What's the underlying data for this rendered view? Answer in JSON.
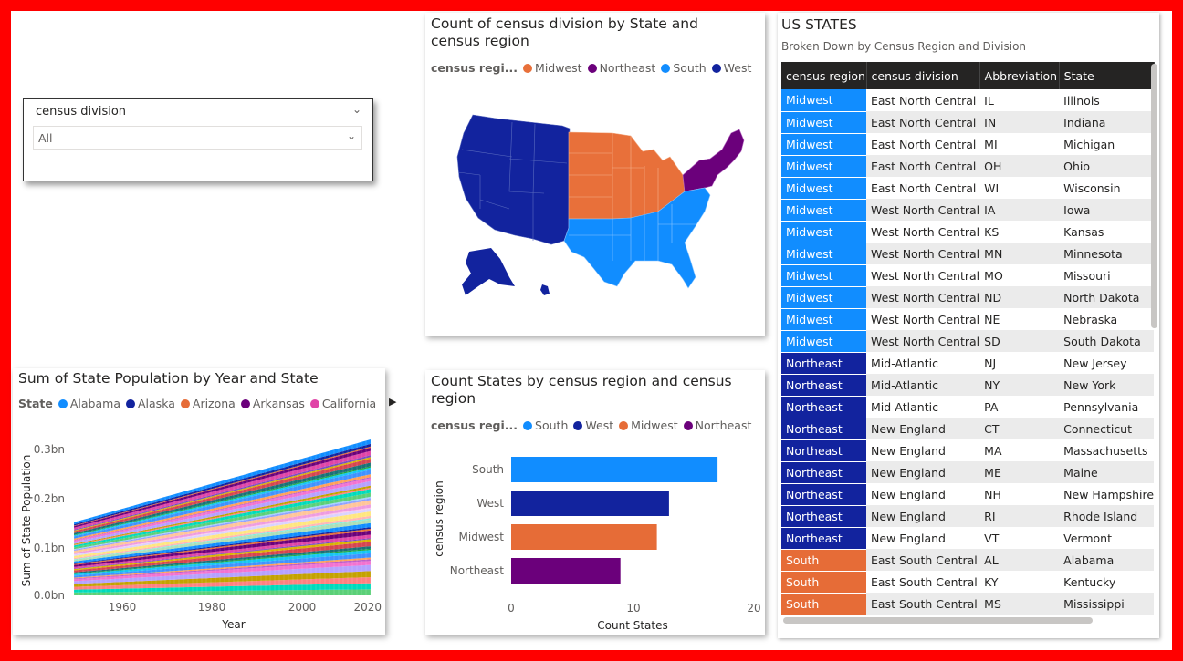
{
  "slicer": {
    "title": "census division",
    "value": "All"
  },
  "map": {
    "title": "Count of census division by State and census region",
    "legend_title": "census regi...",
    "legend": [
      {
        "name": "Midwest",
        "color": "#e8703a"
      },
      {
        "name": "Northeast",
        "color": "#6b007b"
      },
      {
        "name": "South",
        "color": "#118dff"
      },
      {
        "name": "West",
        "color": "#12239e"
      }
    ]
  },
  "area_chart": {
    "title": "Sum of State Population by Year and State",
    "legend_title": "State",
    "legend": [
      {
        "name": "Alabama",
        "color": "#118dff"
      },
      {
        "name": "Alaska",
        "color": "#12239e"
      },
      {
        "name": "Arizona",
        "color": "#e66c37"
      },
      {
        "name": "Arkansas",
        "color": "#6b007b"
      },
      {
        "name": "California",
        "color": "#e044a7"
      }
    ],
    "more_icon": "chevron-right-icon",
    "y_ticks": [
      "0.3bn",
      "0.2bn",
      "0.1bn",
      "0.0bn"
    ],
    "x_ticks": [
      "1960",
      "1980",
      "2000",
      "2020"
    ],
    "xlabel": "Year",
    "ylabel": "Sum of State Population"
  },
  "bar_chart": {
    "title": "Count States by census region and census region",
    "legend_title": "census regi...",
    "legend": [
      {
        "name": "South",
        "color": "#118dff"
      },
      {
        "name": "West",
        "color": "#12239e"
      },
      {
        "name": "Midwest",
        "color": "#e66c37"
      },
      {
        "name": "Northeast",
        "color": "#6b007b"
      }
    ],
    "x_ticks": [
      "0",
      "10",
      "20"
    ],
    "xlabel": "Count States",
    "ylabel": "census region"
  },
  "chart_data": [
    {
      "type": "bar",
      "orientation": "horizontal",
      "title": "Count States by census region and census region",
      "categories": [
        "South",
        "West",
        "Midwest",
        "Northeast"
      ],
      "values": [
        17,
        13,
        12,
        9
      ],
      "colors": [
        "#118dff",
        "#12239e",
        "#e66c37",
        "#6b007b"
      ],
      "xlabel": "Count States",
      "ylabel": "census region",
      "xlim": [
        0,
        20
      ],
      "grid": false
    },
    {
      "type": "area",
      "stacked": true,
      "title": "Sum of State Population by Year and State",
      "x_range": [
        1950,
        2015
      ],
      "series": [
        {
          "name": "Alabama",
          "values": []
        },
        {
          "name": "Alaska",
          "values": []
        },
        {
          "name": "Arizona",
          "values": []
        },
        {
          "name": "Arkansas",
          "values": []
        },
        {
          "name": "California",
          "values": []
        }
      ],
      "total_start": 0.15,
      "total_end": 0.32,
      "unit": "bn",
      "ylim": [
        0,
        0.32
      ],
      "xlabel": "Year",
      "ylabel": "Sum of State Population"
    }
  ],
  "table": {
    "title": "US STATES",
    "subtitle": "Broken Down by Census Region and Division",
    "columns": [
      "census region",
      "census division",
      "Abbreviation",
      "State"
    ],
    "region_colors": {
      "Midwest": "#118dff",
      "Northeast": "#12239e",
      "South": "#e66c37"
    },
    "rows": [
      [
        "Midwest",
        "East North Central",
        "IL",
        "Illinois"
      ],
      [
        "Midwest",
        "East North Central",
        "IN",
        "Indiana"
      ],
      [
        "Midwest",
        "East North Central",
        "MI",
        "Michigan"
      ],
      [
        "Midwest",
        "East North Central",
        "OH",
        "Ohio"
      ],
      [
        "Midwest",
        "East North Central",
        "WI",
        "Wisconsin"
      ],
      [
        "Midwest",
        "West North Central",
        "IA",
        "Iowa"
      ],
      [
        "Midwest",
        "West North Central",
        "KS",
        "Kansas"
      ],
      [
        "Midwest",
        "West North Central",
        "MN",
        "Minnesota"
      ],
      [
        "Midwest",
        "West North Central",
        "MO",
        "Missouri"
      ],
      [
        "Midwest",
        "West North Central",
        "ND",
        "North Dakota"
      ],
      [
        "Midwest",
        "West North Central",
        "NE",
        "Nebraska"
      ],
      [
        "Midwest",
        "West North Central",
        "SD",
        "South Dakota"
      ],
      [
        "Northeast",
        "Mid-Atlantic",
        "NJ",
        "New Jersey"
      ],
      [
        "Northeast",
        "Mid-Atlantic",
        "NY",
        "New York"
      ],
      [
        "Northeast",
        "Mid-Atlantic",
        "PA",
        "Pennsylvania"
      ],
      [
        "Northeast",
        "New England",
        "CT",
        "Connecticut"
      ],
      [
        "Northeast",
        "New England",
        "MA",
        "Massachusetts"
      ],
      [
        "Northeast",
        "New England",
        "ME",
        "Maine"
      ],
      [
        "Northeast",
        "New England",
        "NH",
        "New Hampshire"
      ],
      [
        "Northeast",
        "New England",
        "RI",
        "Rhode Island"
      ],
      [
        "Northeast",
        "New England",
        "VT",
        "Vermont"
      ],
      [
        "South",
        "East South Central",
        "AL",
        "Alabama"
      ],
      [
        "South",
        "East South Central",
        "KY",
        "Kentucky"
      ],
      [
        "South",
        "East South Central",
        "MS",
        "Mississippi"
      ]
    ]
  }
}
